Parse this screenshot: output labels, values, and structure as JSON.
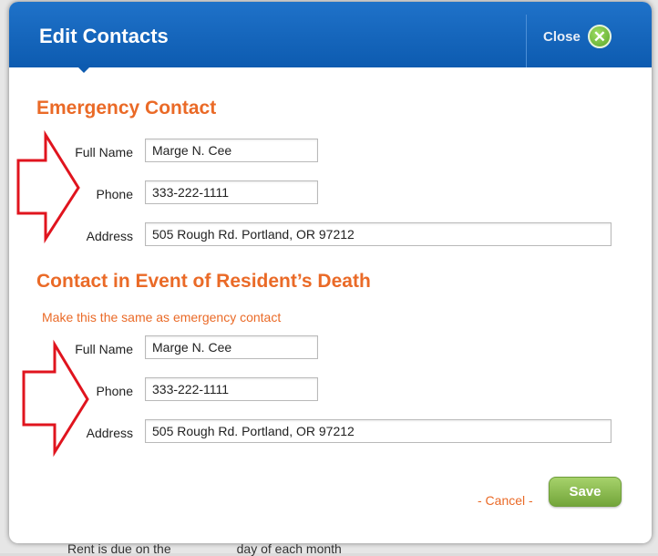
{
  "background": {
    "partial_text_left": "Rent is due on the",
    "partial_text_right": "day of each month"
  },
  "dialog": {
    "title": "Edit Contacts",
    "close_label": "Close",
    "close_icon": "close-x-circle-icon"
  },
  "emergency_contact": {
    "heading": "Emergency Contact",
    "full_name_label": "Full Name",
    "full_name_value": "Marge N. Cee",
    "phone_label": "Phone",
    "phone_value": "333-222-1111",
    "address_label": "Address",
    "address_value": "505 Rough Rd. Portland, OR 97212"
  },
  "death_contact": {
    "heading": "Contact in Event of Resident’s Death",
    "same_as_link": "Make this the same as emergency contact",
    "full_name_label": "Full Name",
    "full_name_value": "Marge N. Cee",
    "phone_label": "Phone",
    "phone_value": "333-222-1111",
    "address_label": "Address",
    "address_value": "505 Rough Rd. Portland, OR 97212"
  },
  "actions": {
    "cancel_label": "- Cancel -",
    "save_label": "Save"
  },
  "colors": {
    "header_blue": "#0d5bb0",
    "accent_orange": "#ea6a27",
    "save_green": "#73a53a",
    "annotation_red": "#e0141e"
  }
}
